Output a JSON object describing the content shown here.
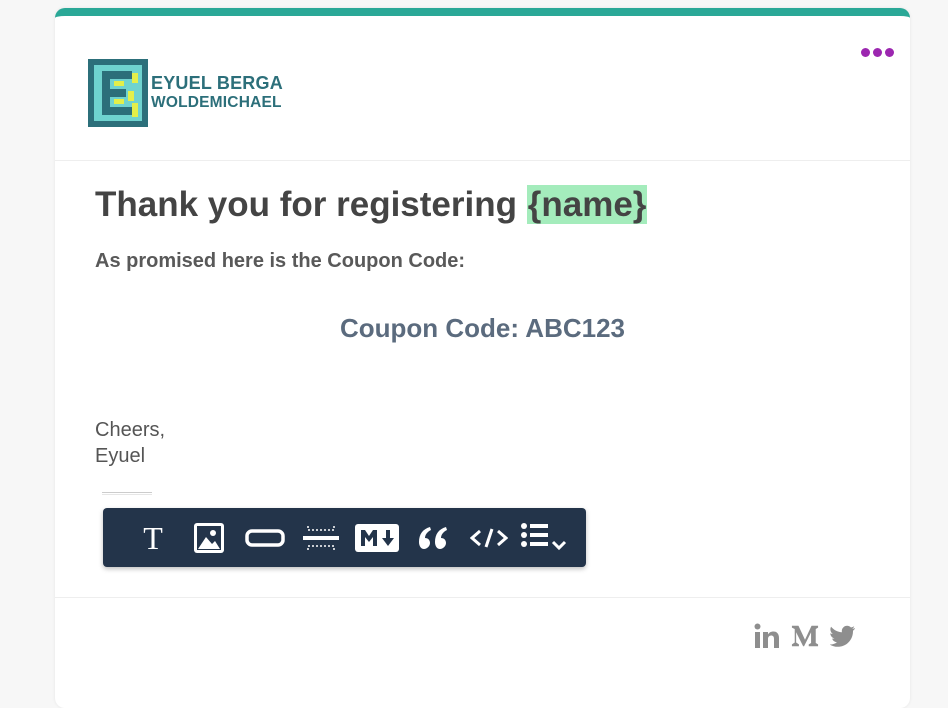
{
  "brand": {
    "name_line1": "EYUEL BERGA",
    "name_line2": "WOLDEMICHAEL",
    "accent_color": "#2aa897",
    "logo_icon": "logo-e-icon"
  },
  "menu": {
    "icon": "more-dots-icon",
    "color": "#9c27b0"
  },
  "content": {
    "title_prefix": "Thank you for registering ",
    "merge_tag": "{name}",
    "subtitle": "As promised here is the Coupon Code:",
    "coupon": "Coupon Code: ABC123",
    "sign_line1": "Cheers,",
    "sign_line2": "Eyuel"
  },
  "toolbar": {
    "text_tool": "T",
    "items": [
      "text-icon",
      "image-icon",
      "button-icon",
      "divider-icon",
      "markdown-icon",
      "quote-icon",
      "code-icon",
      "list-icon"
    ]
  },
  "footer": {
    "socials": [
      "linkedin-icon",
      "medium-icon",
      "twitter-icon"
    ]
  }
}
